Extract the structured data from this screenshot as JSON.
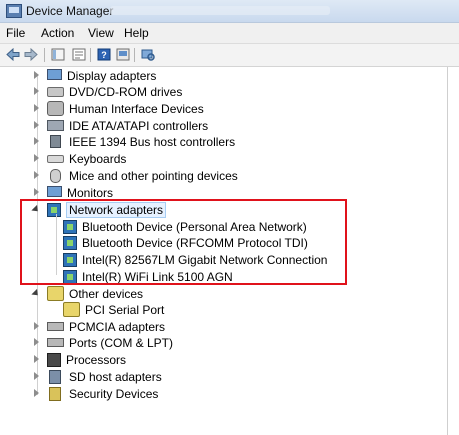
{
  "window": {
    "title": "Device Manager"
  },
  "menubar": {
    "items": [
      "File",
      "Action",
      "View",
      "Help"
    ]
  },
  "toolbar": {
    "icons": [
      "back-arrow-icon",
      "forward-arrow-icon",
      "show-hide-console-tree-icon",
      "properties-icon",
      "help-icon",
      "update-driver-icon",
      "scan-for-hardware-changes-icon"
    ]
  },
  "tree": {
    "categories": [
      {
        "label": "Display adapters",
        "icon": "monitor-icon",
        "expanded": false
      },
      {
        "label": "DVD/CD-ROM drives",
        "icon": "disk-drive-icon",
        "expanded": false
      },
      {
        "label": "Human Interface Devices",
        "icon": "hid-icon",
        "expanded": false
      },
      {
        "label": "IDE ATA/ATAPI controllers",
        "icon": "ide-controller-icon",
        "expanded": false
      },
      {
        "label": "IEEE 1394 Bus host controllers",
        "icon": "firewire-icon",
        "expanded": false
      },
      {
        "label": "Keyboards",
        "icon": "keyboard-icon",
        "expanded": false
      },
      {
        "label": "Mice and other pointing devices",
        "icon": "mouse-icon",
        "expanded": false
      },
      {
        "label": "Monitors",
        "icon": "monitor-icon",
        "expanded": false
      },
      {
        "label": "Network adapters",
        "icon": "network-adapter-icon",
        "expanded": true,
        "children": [
          {
            "label": "Bluetooth Device (Personal Area Network)"
          },
          {
            "label": "Bluetooth Device (RFCOMM Protocol TDI)"
          },
          {
            "label": "Intel(R) 82567LM Gigabit Network Connection"
          },
          {
            "label": "Intel(R) WiFi Link 5100 AGN"
          }
        ]
      },
      {
        "label": "Other devices",
        "icon": "unknown-device-icon",
        "expanded": true,
        "children": [
          {
            "label": "PCI Serial Port"
          }
        ]
      },
      {
        "label": "PCMCIA adapters",
        "icon": "pcmcia-icon",
        "expanded": false
      },
      {
        "label": "Ports (COM & LPT)",
        "icon": "port-icon",
        "expanded": false
      },
      {
        "label": "Processors",
        "icon": "processor-icon",
        "expanded": false
      },
      {
        "label": "SD host adapters",
        "icon": "sd-card-icon",
        "expanded": false
      },
      {
        "label": "Security Devices",
        "icon": "security-device-icon",
        "expanded": false
      }
    ]
  }
}
